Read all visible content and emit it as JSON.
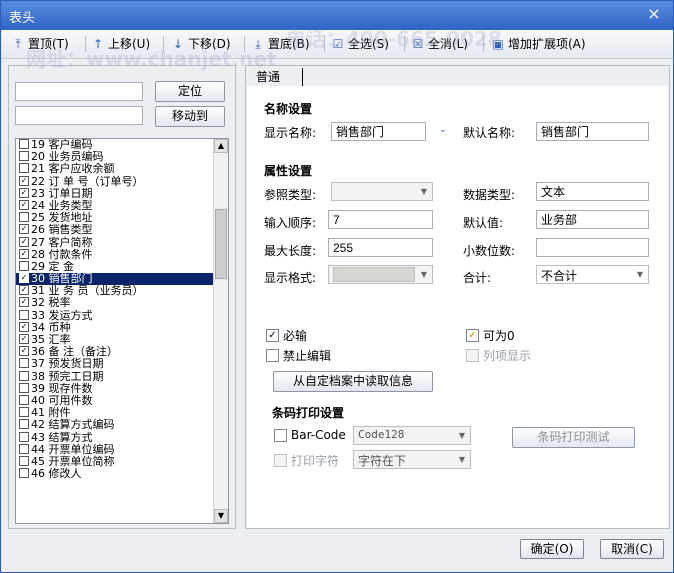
{
  "window": {
    "title": "表头",
    "close_label": "×"
  },
  "toolbar": {
    "items": [
      {
        "label": "置顶(T)",
        "icon": "⤒"
      },
      {
        "label": "上移(U)",
        "icon": "↑"
      },
      {
        "label": "下移(D)",
        "icon": "↓"
      },
      {
        "label": "置底(B)",
        "icon": "⤓"
      },
      {
        "label": "全选(S)",
        "icon": "☑"
      },
      {
        "label": "全消(L)",
        "icon": "☒"
      },
      {
        "label": "增加扩展项(A)",
        "icon": "▣"
      }
    ]
  },
  "left": {
    "locate_value": "",
    "moveto_value": "",
    "locate_label": "定位",
    "moveto_label": "移动到",
    "items": [
      {
        "text": "19  客户编码",
        "checked": false
      },
      {
        "text": "20  业务员编码",
        "checked": false
      },
      {
        "text": "21  客户应收余额",
        "checked": false
      },
      {
        "text": "22  订 单 号（订单号）",
        "checked": true
      },
      {
        "text": "23  订单日期",
        "checked": true
      },
      {
        "text": "24  业务类型",
        "checked": true
      },
      {
        "text": "25  发货地址",
        "checked": false
      },
      {
        "text": "26  销售类型",
        "checked": true
      },
      {
        "text": "27  客户简称",
        "checked": true
      },
      {
        "text": "28  付款条件",
        "checked": true
      },
      {
        "text": "29  定    金",
        "checked": false
      },
      {
        "text": "30  销售部门",
        "checked": true,
        "selected": true
      },
      {
        "text": "31  业 务 员（业务员）",
        "checked": true
      },
      {
        "text": "32  税率",
        "checked": true
      },
      {
        "text": "33  发运方式",
        "checked": false
      },
      {
        "text": "34  币种",
        "checked": true
      },
      {
        "text": "35  汇率",
        "checked": true
      },
      {
        "text": "36  备    注（备注）",
        "checked": true
      },
      {
        "text": "37  预发货日期",
        "checked": false
      },
      {
        "text": "38  预完工日期",
        "checked": false
      },
      {
        "text": "39  现存件数",
        "checked": false
      },
      {
        "text": "40  可用件数",
        "checked": false
      },
      {
        "text": "41  附件",
        "checked": false
      },
      {
        "text": "42  结算方式编码",
        "checked": false
      },
      {
        "text": "43  结算方式",
        "checked": false
      },
      {
        "text": "44  开票单位编码",
        "checked": false
      },
      {
        "text": "45  开票单位简称",
        "checked": false
      },
      {
        "text": "46  修改人",
        "checked": false
      }
    ]
  },
  "right": {
    "tab": "普通",
    "name_section": {
      "title": "名称设置",
      "display_label": "显示名称:",
      "display_value": "销售部门",
      "default_label": "默认名称:",
      "default_value": "销售部门"
    },
    "attr_section": {
      "title": "属性设置",
      "ref_type_label": "参照类型:",
      "data_type_label": "数据类型:",
      "data_type_value": "文本",
      "input_order_label": "输入顺序:",
      "input_order_value": "7",
      "default_value_label": "默认值:",
      "default_value_value": "业务部",
      "max_len_label": "最大长度:",
      "max_len_value": "255",
      "decimals_label": "小数位数:",
      "decimals_value": "",
      "format_label": "显示格式:",
      "total_label": "合计:",
      "total_value": "不合计"
    },
    "checks": {
      "required": {
        "label": "必输",
        "checked": true
      },
      "nullable": {
        "label": "可为0",
        "checked": true
      },
      "no_edit": {
        "label": "禁止编辑",
        "checked": false
      },
      "col_display": {
        "label": "列项显示",
        "checked": false
      }
    },
    "read_btn": "从自定档案中读取信息",
    "barcode_section": {
      "title": "条码打印设置",
      "barcode_label": "Bar-Code",
      "barcode_value": "Code128",
      "print_chars_label": "打印字符",
      "print_chars_value": "字符在下",
      "test_btn": "条码打印测试"
    }
  },
  "footer": {
    "ok": "确定(O)",
    "cancel": "取消(C)"
  },
  "watermark": {
    "phone": "电话：400-665-0028",
    "site": "网址：www.chanjet.net"
  }
}
